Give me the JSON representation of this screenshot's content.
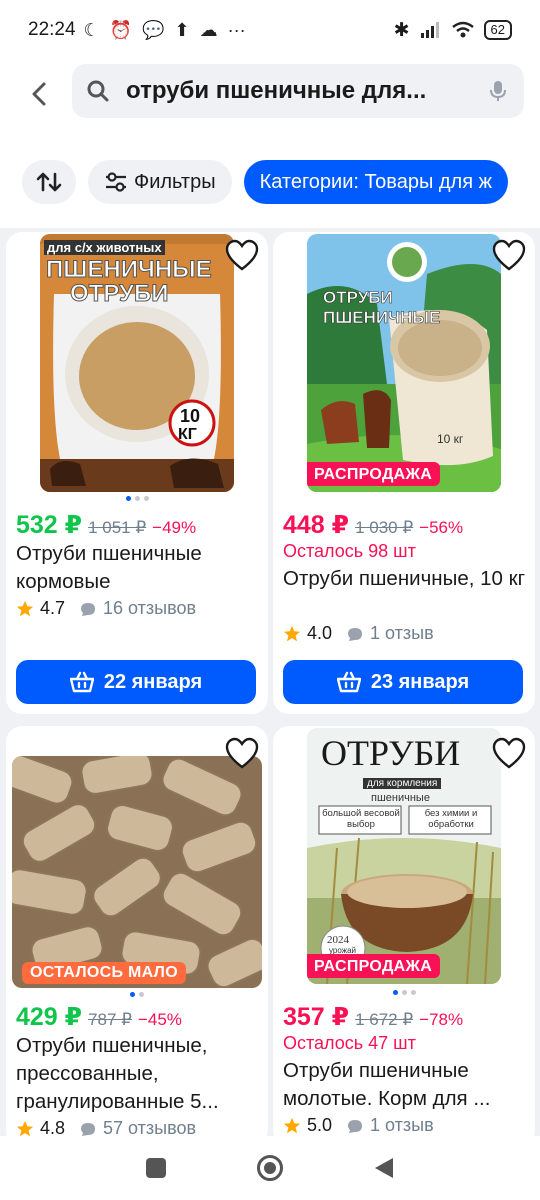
{
  "status_bar": {
    "time": "22:24",
    "battery": "62"
  },
  "search": {
    "query": "отруби пшеничные для..."
  },
  "chips": {
    "filters": "Фильтры",
    "category": "Категории: Товары для ж"
  },
  "products": [
    {
      "img_text_top": "для с/х животных",
      "img_text_main1": "ПШЕНИЧНЫЕ",
      "img_text_main2": "ОТРУБИ",
      "img_weight1": "10",
      "img_weight2": "КГ",
      "price": "532 ₽",
      "old_price": "1 051 ₽",
      "discount": "−49%",
      "title": "Отруби пшеничные кормовые",
      "rating": "4.7",
      "reviews": "16 отзывов",
      "delivery": "22 января"
    },
    {
      "img_text_main1": "ОТРУБИ",
      "img_text_main2": "ПШЕНИЧНЫЕ",
      "img_weight": "10 кг",
      "badge": "РАСПРОДАЖА",
      "price": "448 ₽",
      "old_price": "1 030 ₽",
      "discount": "−56%",
      "stock": "Осталось 98 шт",
      "title": "Отруби пшеничные, 10 кг",
      "rating": "4.0",
      "reviews": "1 отзыв",
      "delivery": "23 января"
    },
    {
      "badge": "ОСТАЛОСЬ МАЛО",
      "price": "429 ₽",
      "old_price": "787 ₽",
      "discount": "−45%",
      "title": "Отруби пшеничные, прессованные, гранулированные 5...",
      "rating": "4.8",
      "reviews": "57 отзывов"
    },
    {
      "img_text_main": "ОТРУБИ",
      "img_text_sub": "для кормления",
      "img_text_sub2": "пшеничные",
      "img_box1": "большой весовой выбор",
      "img_box2": "без химии и обработки",
      "img_year": "2024",
      "img_year_sub": "урожай",
      "badge": "РАСПРОДАЖА",
      "price": "357 ₽",
      "old_price": "1 672 ₽",
      "discount": "−78%",
      "stock": "Осталось 47 шт",
      "title": "Отруби пшеничные молотые. Корм для ...",
      "rating": "5.0",
      "reviews": "1 отзыв"
    }
  ],
  "colors": {
    "accent": "#005bff",
    "sale": "#f91155",
    "green_price": "#10c44c",
    "star": "#ffa800"
  }
}
